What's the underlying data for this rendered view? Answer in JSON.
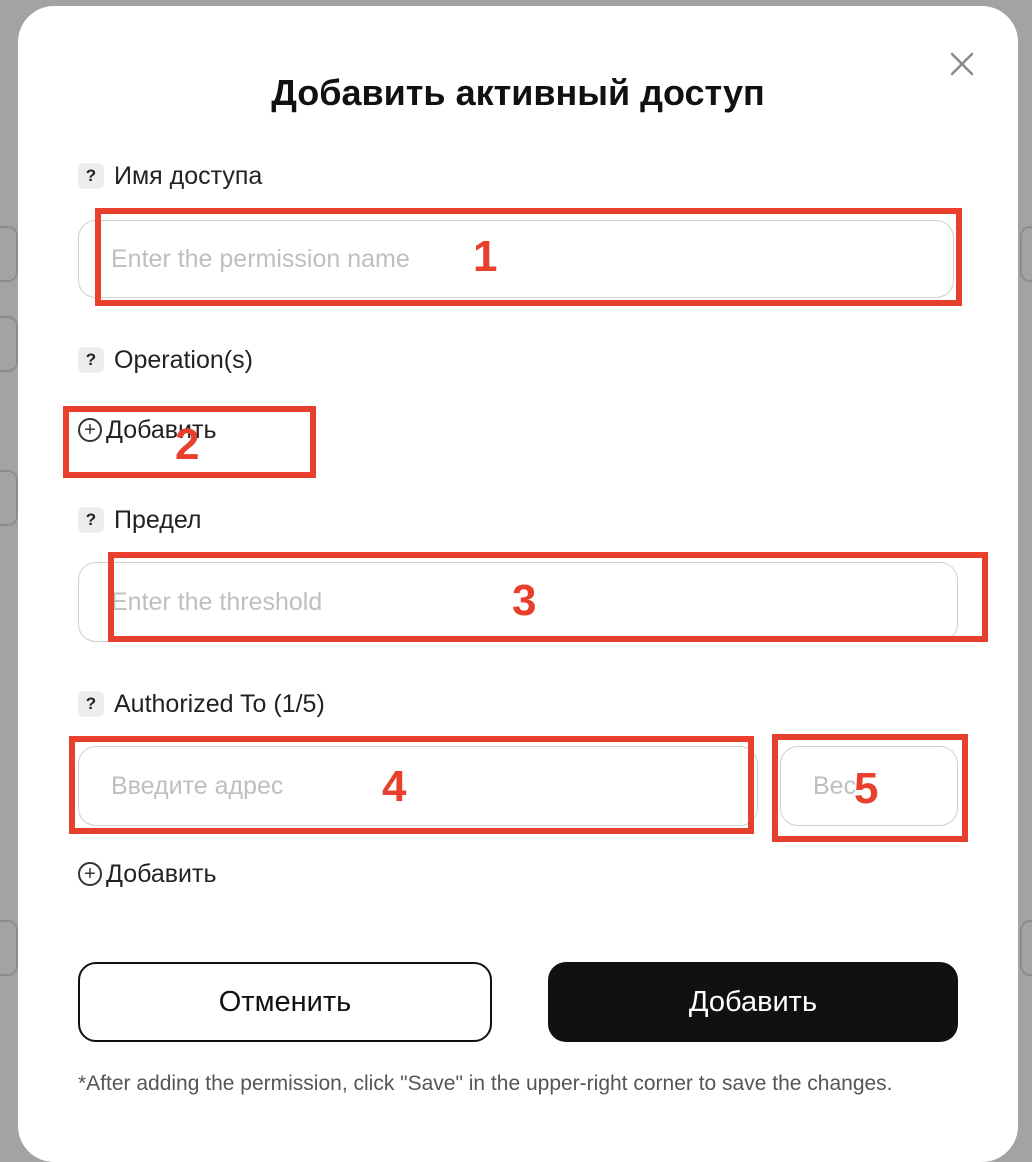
{
  "modal": {
    "title": "Добавить активный доступ",
    "close_icon": "close-icon"
  },
  "fields": {
    "permission_name": {
      "label": "Имя доступа",
      "placeholder": "Enter the permission name"
    },
    "operations": {
      "label": "Operation(s)",
      "add_label": "Добавить"
    },
    "threshold": {
      "label": "Предел",
      "placeholder": "Enter the threshold"
    },
    "authorized_to": {
      "label": "Authorized To (1/5)",
      "address_placeholder": "Введите адрес",
      "weight_placeholder": "Вес",
      "add_label": "Добавить"
    }
  },
  "help_glyph": "?",
  "buttons": {
    "cancel": "Отменить",
    "add": "Добавить"
  },
  "footnote": "*After adding the permission, click \"Save\" in the upper-right corner to save the changes.",
  "annotations": [
    "1",
    "2",
    "3",
    "4",
    "5"
  ],
  "colors": {
    "annotation": "#e8402c",
    "primary_button": "#111111",
    "placeholder": "#bfbfbf"
  }
}
